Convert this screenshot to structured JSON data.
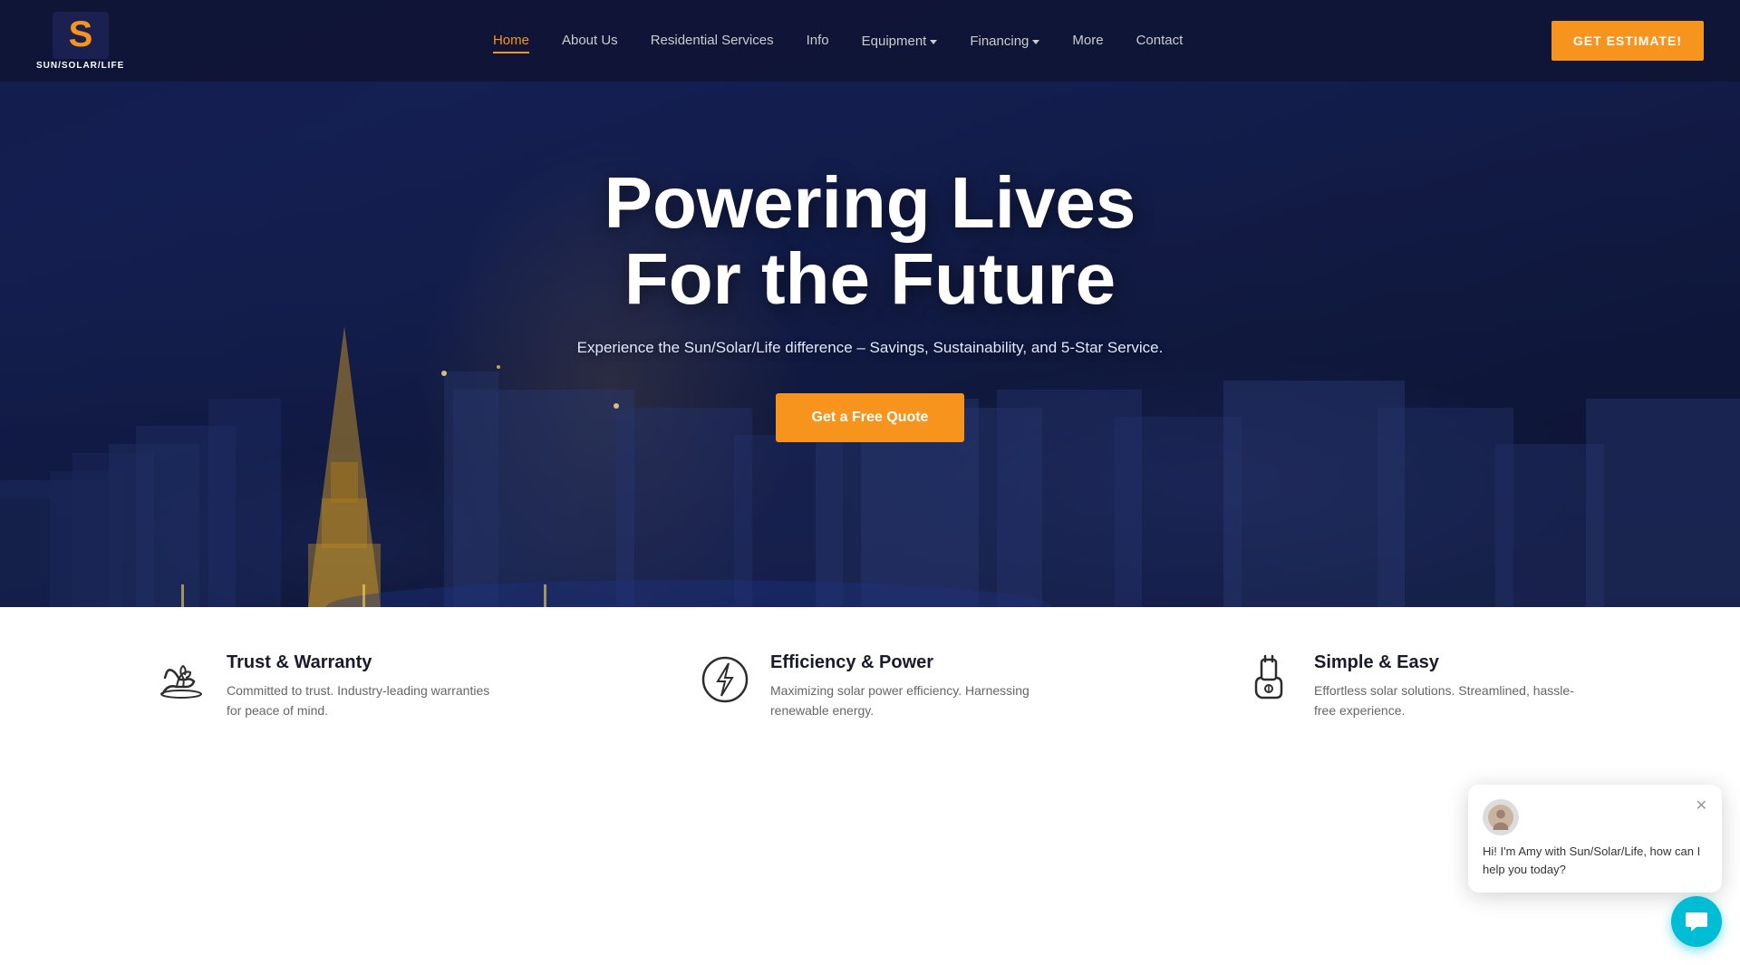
{
  "brand": {
    "name": "SUN/SOLAR/LIFE",
    "logo_letter": "S"
  },
  "nav": {
    "links": [
      {
        "id": "home",
        "label": "Home",
        "active": true,
        "has_dropdown": false
      },
      {
        "id": "about",
        "label": "About Us",
        "active": false,
        "has_dropdown": false
      },
      {
        "id": "residential",
        "label": "Residential Services",
        "active": false,
        "has_dropdown": false
      },
      {
        "id": "info",
        "label": "Info",
        "active": false,
        "has_dropdown": false
      },
      {
        "id": "equipment",
        "label": "Equipment",
        "active": false,
        "has_dropdown": true
      },
      {
        "id": "financing",
        "label": "Financing",
        "active": false,
        "has_dropdown": true
      },
      {
        "id": "more",
        "label": "More",
        "active": false,
        "has_dropdown": false
      },
      {
        "id": "contact",
        "label": "Contact",
        "active": false,
        "has_dropdown": false
      }
    ],
    "cta_label": "GET ESTIMATE!"
  },
  "hero": {
    "title_line1": "Powering Lives",
    "title_line2": "For the Future",
    "subtitle": "Experience the Sun/Solar/Life difference – Savings, Sustainability, and 5-Star Service.",
    "cta_label": "Get a Free Quote"
  },
  "features": [
    {
      "id": "trust",
      "icon": "trust-icon",
      "title": "Trust & Warranty",
      "description": "Committed to trust. Industry-leading warranties for peace of mind."
    },
    {
      "id": "efficiency",
      "icon": "efficiency-icon",
      "title": "Efficiency & Power",
      "description": "Maximizing solar power efficiency. Harnessing renewable energy."
    },
    {
      "id": "simple",
      "icon": "simple-icon",
      "title": "Simple & Easy",
      "description": "Effortless solar solutions. Streamlined, hassle-free experience."
    }
  ],
  "chat": {
    "avatar_alt": "Amy avatar",
    "message": "Hi! I'm Amy with Sun/Solar/Life, how can I help you today?"
  }
}
